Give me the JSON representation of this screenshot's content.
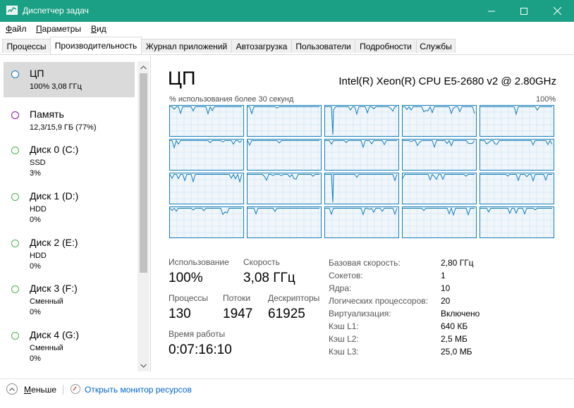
{
  "window": {
    "title": "Диспетчер задач",
    "title_bar_color": "#1ba085",
    "controls": [
      "minimize-icon",
      "maximize-icon",
      "close-icon"
    ]
  },
  "menu": {
    "items": [
      {
        "label": "Файл",
        "hotkey": "Ф",
        "rest": "айл"
      },
      {
        "label": "Параметры",
        "hotkey": "П",
        "rest": "араметры"
      },
      {
        "label": "Вид",
        "hotkey": "В",
        "rest": "ид"
      }
    ]
  },
  "tabs": [
    "Процессы",
    "Производительность",
    "Журнал приложений",
    "Автозагрузка",
    "Пользователи",
    "Подробности",
    "Службы"
  ],
  "sidebar": {
    "items": [
      {
        "name": "ЦП",
        "line1": "100% 3,08 ГГц",
        "line2": "",
        "color": "#117dbb"
      },
      {
        "name": "Память",
        "line1": "12,3/15,9 ГБ (77%)",
        "line2": "",
        "color": "#8b12ae"
      },
      {
        "name": "Диск 0 (C:)",
        "line1": "SSD",
        "line2": "3%",
        "color": "#4da60c"
      },
      {
        "name": "Диск 1 (D:)",
        "line1": "HDD",
        "line2": "0%",
        "color": "#4da60c"
      },
      {
        "name": "Диск 2 (E:)",
        "line1": "HDD",
        "line2": "0%",
        "color": "#4da60c"
      },
      {
        "name": "Диск 3 (F:)",
        "line1": "Сменный",
        "line2": "0%",
        "color": "#4da60c"
      },
      {
        "name": "Диск 4 (G:)",
        "line1": "Сменный",
        "line2": "0%",
        "color": "#4da60c"
      }
    ]
  },
  "cpu": {
    "title": "ЦП",
    "model": "Intel(R) Xeon(R) CPU E5-2680 v2 @ 2.80GHz",
    "graph_caption": "% использования более 30 секунд",
    "graph_max": "100%",
    "graph_color": "#117dbb",
    "core_count_shown": 20,
    "stats": {
      "usage_label": "Использование",
      "usage_value": "100%",
      "speed_label": "Скорость",
      "speed_value": "3,08 ГГц",
      "processes_label": "Процессы",
      "processes_value": "130",
      "threads_label": "Потоки",
      "threads_value": "1947",
      "handles_label": "Дескрипторы",
      "handles_value": "61925",
      "uptime_label": "Время работы",
      "uptime_value": "0:07:16:10"
    },
    "specs": [
      {
        "label": "Базовая скорость:",
        "value": "2,80 ГГц"
      },
      {
        "label": "Сокетов:",
        "value": "1"
      },
      {
        "label": "Ядра:",
        "value": "10"
      },
      {
        "label": "Логических процессоров:",
        "value": "20"
      },
      {
        "label": "Виртуализация:",
        "value": "Включено"
      },
      {
        "label": "Кэш L1:",
        "value": "640 КБ"
      },
      {
        "label": "Кэш L2:",
        "value": "2,5 МБ"
      },
      {
        "label": "Кэш L3:",
        "value": "25,0 МБ"
      }
    ]
  },
  "footer": {
    "fewer_label": "Меньше",
    "fewer_hotkey": "М",
    "fewer_rest": "еньше",
    "resource_monitor": "Открыть монитор ресурсов"
  }
}
